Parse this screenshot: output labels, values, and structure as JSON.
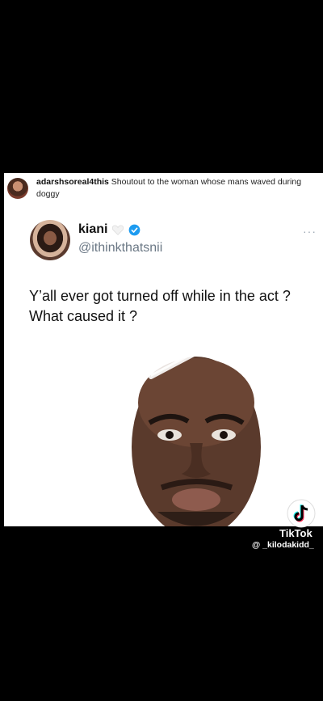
{
  "comment": {
    "username": "adarshsoreal4this",
    "text": " Shoutout to the woman whose mans waved during doggy"
  },
  "tweet": {
    "name": "kiani",
    "handle": "@ithinkthatsnii",
    "body": "Y’all ever got turned off while in the act ? What caused it ?"
  },
  "watermark": {
    "brand": "TikTok",
    "handle": "@ _kilodakidd_"
  },
  "icons": [
    "white-heart-icon",
    "verified-badge-icon",
    "more-options-icon",
    "play-icon",
    "tiktok-logo-icon"
  ],
  "colors": {
    "verified": "#1d9bf0",
    "handle": "#6b7885",
    "background": "#000000"
  }
}
